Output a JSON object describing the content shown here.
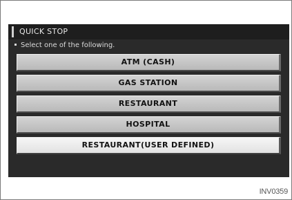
{
  "header": {
    "title": "QUICK STOP"
  },
  "instruction": {
    "text": "Select one of the following."
  },
  "menu": {
    "items": [
      {
        "label": "ATM (CASH)",
        "selected": false
      },
      {
        "label": "GAS STATION",
        "selected": false
      },
      {
        "label": "RESTAURANT",
        "selected": false
      },
      {
        "label": "HOSPITAL",
        "selected": false
      },
      {
        "label": "RESTAURANT(USER DEFINED)",
        "selected": true
      }
    ]
  },
  "figure": {
    "id": "INV0359"
  },
  "colors": {
    "title_bar": "#1e1e1e",
    "panel": "#2a2a2a",
    "button": "#c6c6c6",
    "button_selected": "#efefef"
  }
}
